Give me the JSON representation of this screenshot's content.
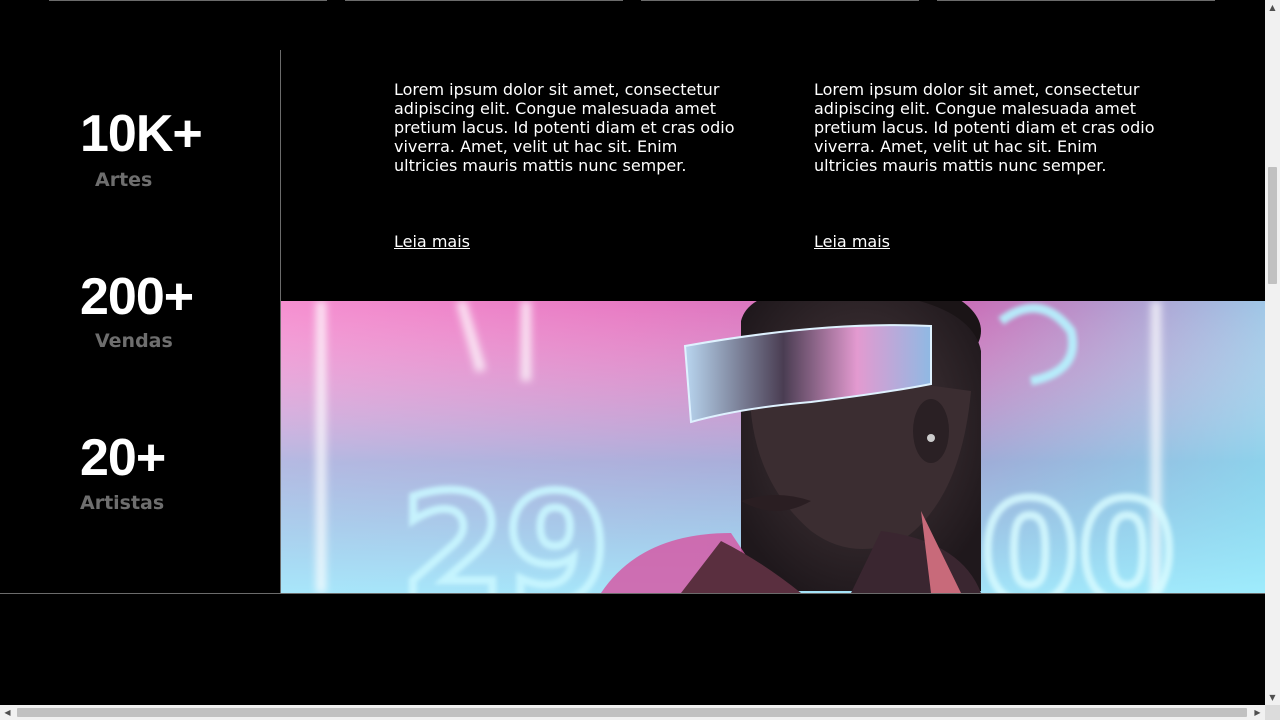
{
  "stats": [
    {
      "number": "10K+",
      "label": "Artes"
    },
    {
      "number": "200+",
      "label": "Vendas"
    },
    {
      "number": "20+",
      "label": "Artistas"
    }
  ],
  "cards": [
    {
      "text": "Lorem ipsum dolor sit amet, consectetur adipiscing elit. Congue malesuada amet pretium lacus. Id potenti diam et cras odio viverra. Amet, velit ut hac sit. Enim ultricies mauris mattis nunc semper.",
      "link": "Leia mais"
    },
    {
      "text": "Lorem ipsum dolor sit amet, consectetur adipiscing elit. Congue malesuada amet pretium lacus. Id potenti diam et cras odio viverra. Amet, velit ut hac sit. Enim ultricies mauris mattis nunc semper.",
      "link": "Leia mais"
    }
  ],
  "hero_image": {
    "neon_text": "29"
  },
  "colors": {
    "background": "#000000",
    "muted_label": "#6e6e6e",
    "divider": "#6b6b6b",
    "neon_pink": "#e46fb8",
    "neon_cyan": "#7fdcf0"
  },
  "scrollbars": {
    "up_icon": "triangle-up",
    "down_icon": "triangle-down",
    "left_icon": "triangle-left",
    "right_icon": "triangle-right"
  }
}
